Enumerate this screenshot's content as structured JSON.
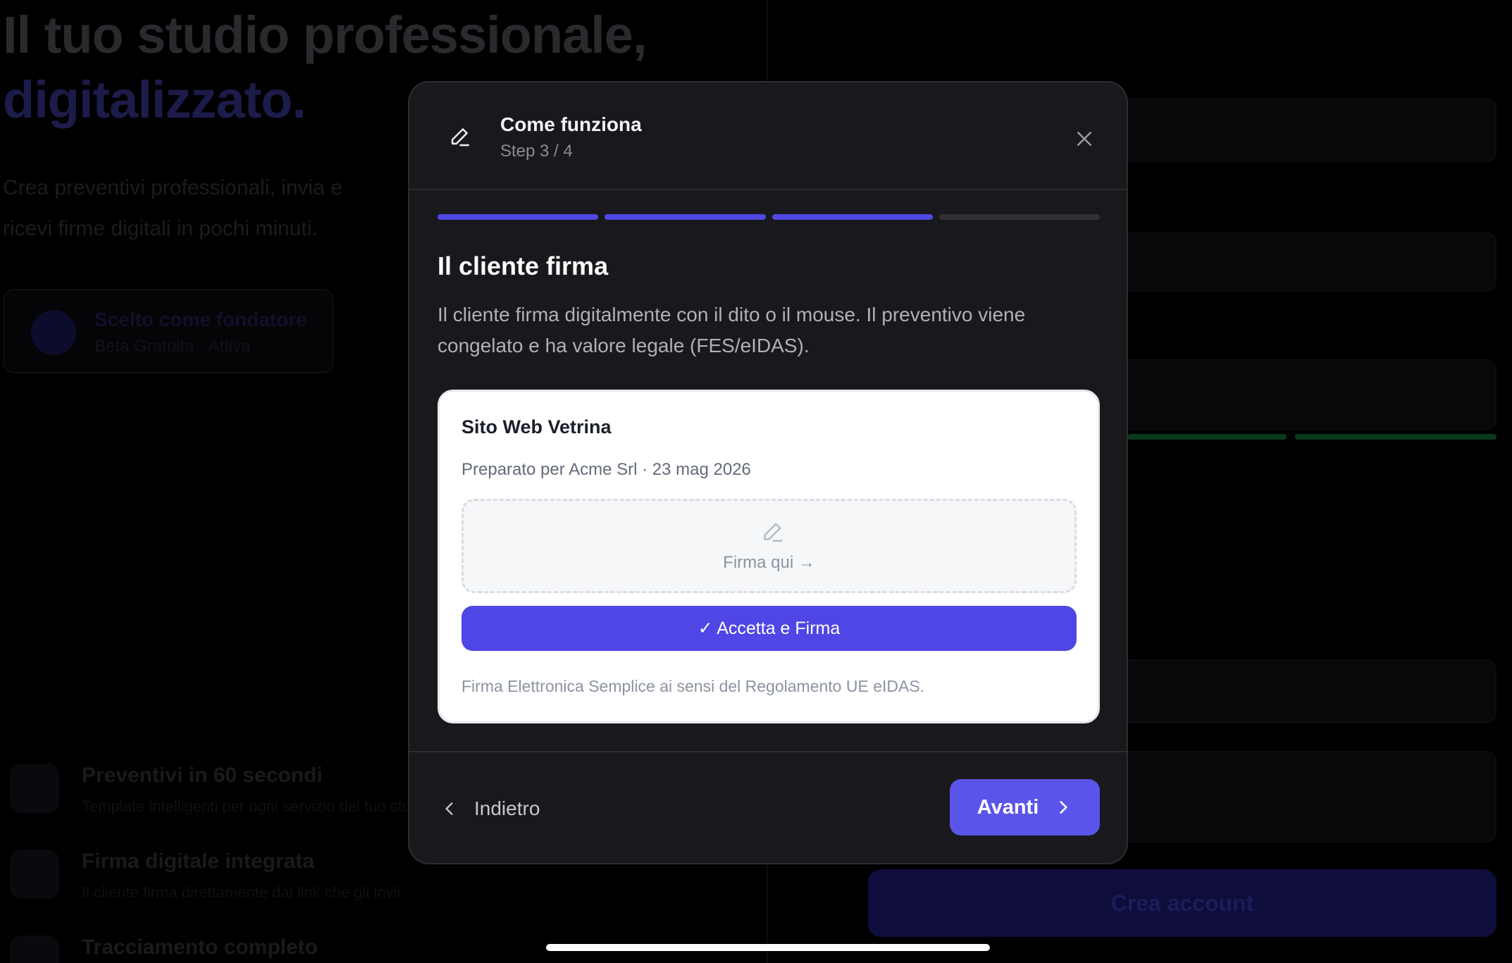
{
  "background": {
    "hero_line1": "Il tuo studio professionale,",
    "hero_line2": "digitalizzato.",
    "hero_sub": "Crea preventivi professionali, invia e ricevi firme digitali in pochi minuti.",
    "plan_title": "Scelto come fondatore",
    "plan_sub": "Beta Gratuita · Attiva",
    "features": [
      {
        "title": "Preventivi in 60 secondi",
        "sub": "Template intelligenti per ogni servizio del tuo studio"
      },
      {
        "title": "Firma digitale integrata",
        "sub": "Il cliente firma direttamente dal link che gli invii"
      },
      {
        "title": "Tracciamento completo",
        "sub": ""
      }
    ],
    "cta_label": "Crea account"
  },
  "modal": {
    "header": {
      "title": "Come funziona",
      "step": "Step 3 / 4"
    },
    "progress": {
      "total": 4,
      "completed": 3
    },
    "step_title": "Il cliente firma",
    "step_description": "Il cliente firma digitalmente con il dito o il mouse. Il preventivo viene congelato e ha valore legale (FES/eIDAS).",
    "preview": {
      "title": "Sito Web Vetrina",
      "meta": "Preparato per Acme Srl · 23 mag 2026",
      "signature_label": "Firma qui →",
      "accept_label": "✓ Accetta e Firma",
      "legal_note": "Firma Elettronica Semplice ai sensi del Regolamento UE eIDAS."
    },
    "footer": {
      "back_label": "Indietro",
      "next_label": "Avanti"
    }
  },
  "colors": {
    "accent": "#5048e5",
    "modal_bg": "#19191d",
    "card_bg": "#ffffff"
  },
  "icons": {
    "header": "pen-icon",
    "close": "close-icon",
    "signature": "pen-icon",
    "back": "chevron-left-icon",
    "next": "chevron-right-icon"
  }
}
